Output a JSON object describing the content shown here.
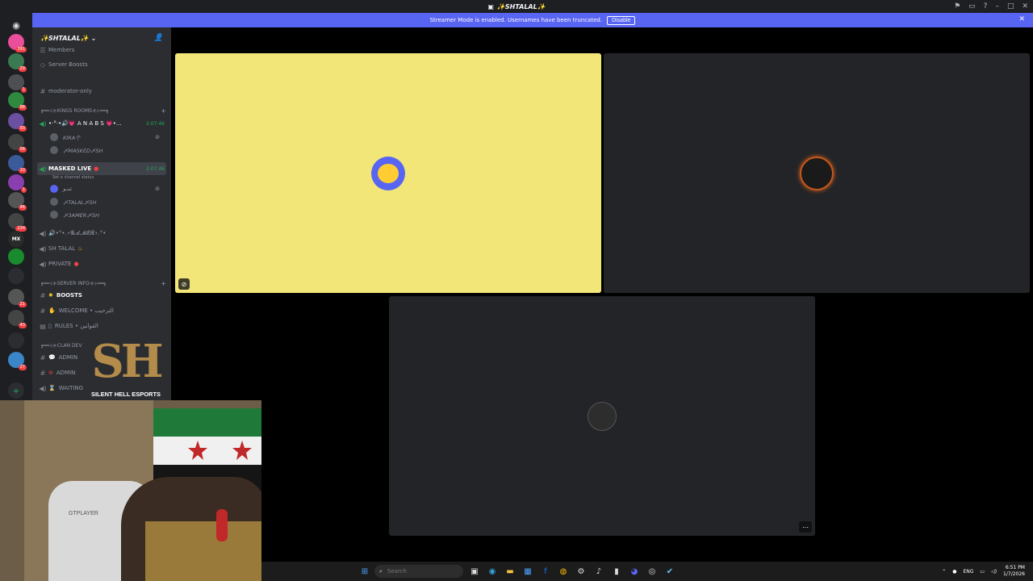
{
  "window": {
    "title": "✨SHTALAL✨",
    "title_icon": "server-avatar-icon"
  },
  "banner": {
    "text": "Streamer Mode is enabled. Usernames have been truncated.",
    "disable_label": "Disable"
  },
  "server": {
    "name": "✨SHTALAL✨"
  },
  "sidebar": {
    "members": "Members",
    "server_boosts": "Server Boosts",
    "moderator_only": "moderator-only",
    "cat_kings": "╔══⊹⊱KINGS ROOMS⊰⊹══╗",
    "voice_anabs": "•·°·•🔊💗 A N A B S 💗•...",
    "voice_anabs_time": "2:07:46",
    "user_kira": "KIRA个",
    "user_masked": "〆MASKED〆SH",
    "voice_masked_live": "MASKED LIVE",
    "voice_masked_live_time": "2:07:46",
    "set_status": "Set a channel status",
    "user_arabic": "مَنـو",
    "user_talal": "〆TALAL〆SH",
    "user_samer": "〆3AMER〆SH",
    "voice_gamer": "🔊•°•.⋆𝓖𝓐𝓜𝓔𝓡⋆.°•",
    "voice_shtalal": "SH TALAL",
    "voice_private": "PRIVATE",
    "cat_server_info": "╔══⊹⊱SERVER INFO⊰⊹══╗",
    "ch_boosts": "BOOSTS",
    "ch_welcome": "WELCOME • الترحيب",
    "ch_rules": "RULES • القوانين",
    "cat_clan": "╔══⊹⊱CLAN DEV",
    "ch_admin1": "ADMIN",
    "ch_admin2": "ADMIN",
    "ch_waiting": "WAITING"
  },
  "rail_badges": [
    "391",
    "29",
    "1",
    "88",
    "93",
    "56",
    "10",
    "1",
    "46",
    "234",
    "MX",
    "",
    "",
    "21",
    "43",
    "",
    "27"
  ],
  "logo": {
    "letters": "SH",
    "brand": "SILENT HELL ESPORTS"
  },
  "webcam": {
    "chair_label": "GTPLAYER"
  },
  "taskbar": {
    "search_placeholder": "Search",
    "lang": "ENG",
    "time": "6:51 PM",
    "date": "1/7/2026"
  },
  "colors": {
    "accent": "#5865f2",
    "tile1": "#f2e679",
    "tile_dark": "#232427",
    "voice_green": "#23a55a"
  }
}
